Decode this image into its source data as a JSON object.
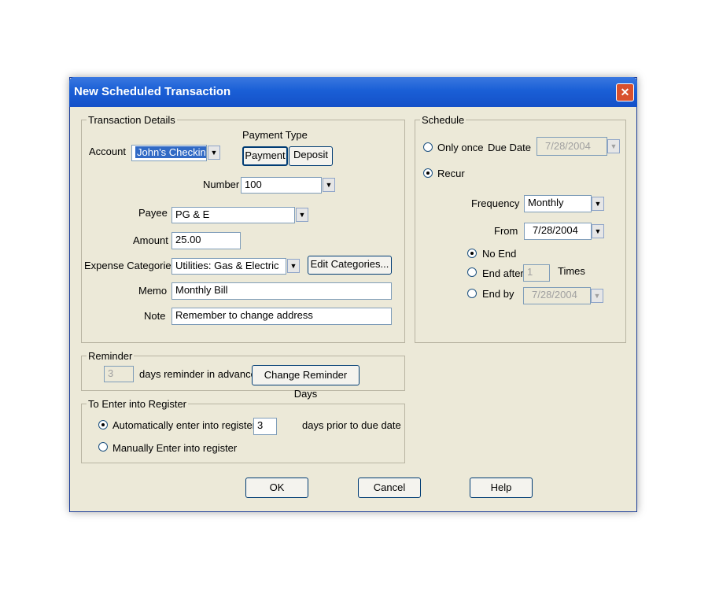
{
  "window": {
    "title": "New Scheduled Transaction",
    "close_glyph": "✕"
  },
  "transaction_details": {
    "legend": "Transaction Details",
    "account_label": "Account",
    "account_value": "John's Checking",
    "payment_type_label": "Payment Type",
    "payment_button": "Payment",
    "deposit_button": "Deposit",
    "number_label": "Number",
    "number_value": "100",
    "payee_label": "Payee",
    "payee_value": "PG & E",
    "amount_label": "Amount",
    "amount_value": "25.00",
    "expense_categories_label": "Expense Categories",
    "expense_categories_value": "Utilities: Gas & Electric",
    "edit_categories_button": "Edit Categories...",
    "memo_label": "Memo",
    "memo_value": "Monthly Bill",
    "note_label": "Note",
    "note_value": "Remember to change address"
  },
  "schedule": {
    "legend": "Schedule",
    "only_once_label": "Only once",
    "due_date_label": "Due Date",
    "due_date_value": "7/28/2004",
    "recur_label": "Recur",
    "frequency_label": "Frequency",
    "frequency_value": "Monthly",
    "from_label": "From",
    "from_value": "7/28/2004",
    "no_end_label": "No End",
    "end_after_label": "End after",
    "end_after_value": "1",
    "times_label": "Times",
    "end_by_label": "End by",
    "end_by_value": "7/28/2004",
    "selected": "recur",
    "end_selected": "no_end"
  },
  "reminder": {
    "legend": "Reminder",
    "days_value": "3",
    "days_text": "days reminder in advance",
    "change_button": "Change Reminder Days"
  },
  "register": {
    "legend": "To Enter into Register",
    "auto_label": "Automatically enter into register",
    "auto_days_value": "3",
    "days_prior_text": "days prior to due date",
    "manual_label": "Manually Enter into register",
    "selected": "auto"
  },
  "footer": {
    "ok": "OK",
    "cancel": "Cancel",
    "help": "Help"
  },
  "icons": {
    "dropdown": "chevron-down-icon",
    "close": "close-icon"
  }
}
